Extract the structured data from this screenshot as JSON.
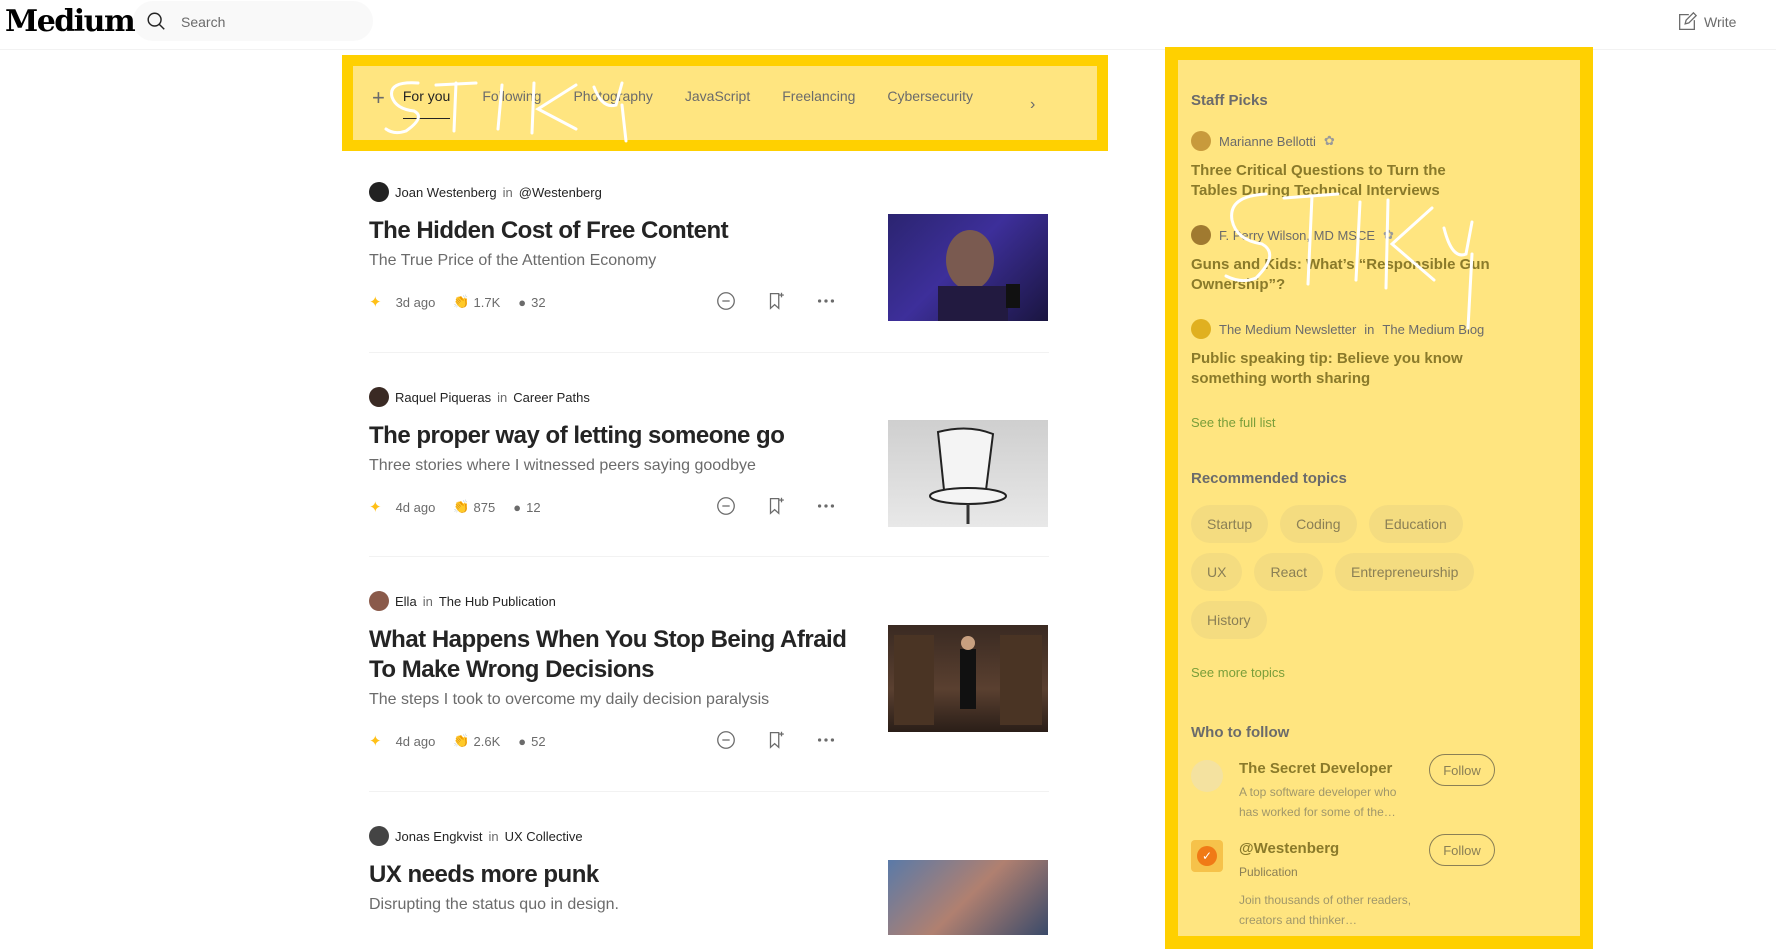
{
  "header": {
    "logo": "Medium",
    "search_placeholder": "Search",
    "write_label": "Write"
  },
  "highlight_color": "#ffd000",
  "tabs": {
    "plus": "+",
    "items": [
      "For you",
      "Following",
      "Photography",
      "JavaScript",
      "Freelancing",
      "Cybersecurity"
    ],
    "active": "For you",
    "next": "›"
  },
  "feed": [
    {
      "author": "Joan Westenberg",
      "in": "in",
      "publication": "@Westenberg",
      "title": "The Hidden Cost of Free Content",
      "subtitle": "The True Price of the Attention Economy",
      "ago": "3d ago",
      "claps": "1.7K",
      "responses": "32"
    },
    {
      "author": "Raquel Piqueras",
      "in": "in",
      "publication": "Career Paths",
      "title": "The proper way of letting someone go",
      "subtitle": "Three stories where I witnessed peers saying goodbye",
      "ago": "4d ago",
      "claps": "875",
      "responses": "12"
    },
    {
      "author": "Ella",
      "in": "in",
      "publication": "The Hub Publication",
      "title": "What Happens When You Stop Being Afraid To Make Wrong Decisions",
      "subtitle": "The steps I took to overcome my daily decision paralysis",
      "ago": "4d ago",
      "claps": "2.6K",
      "responses": "52"
    },
    {
      "author": "Jonas Engkvist",
      "in": "in",
      "publication": "UX Collective",
      "title": "UX needs more punk",
      "subtitle": "Disrupting the status quo in design."
    }
  ],
  "sidebar": {
    "staff_picks_title": "Staff Picks",
    "picks": [
      {
        "author": "Marianne Bellotti",
        "title": "Three Critical Questions to Turn the Tables During Technical Interviews"
      },
      {
        "author": "F. Perry Wilson, MD MSCE",
        "title": "Guns and Kids: What’s “Responsible Gun Ownership”?"
      },
      {
        "author": "The Medium Newsletter",
        "in": "in",
        "publication": "The Medium Blog",
        "title": "Public speaking tip: Believe you know something worth sharing"
      }
    ],
    "see_full_list": "See the full list",
    "topics_title": "Recommended topics",
    "topics": [
      "Startup",
      "Coding",
      "Education",
      "UX",
      "React",
      "Entrepreneurship",
      "History"
    ],
    "see_more_topics": "See more topics",
    "follow_title": "Who to follow",
    "follow": [
      {
        "name": "The Secret Developer",
        "desc": "A top software developer who has worked for some of the…",
        "button": "Follow"
      },
      {
        "name": "@Westenberg",
        "kind": "Publication",
        "desc": "Join thousands of other readers, creators and thinker…",
        "button": "Follow"
      }
    ]
  },
  "annotations": {
    "scribble_text": "STIKY"
  }
}
